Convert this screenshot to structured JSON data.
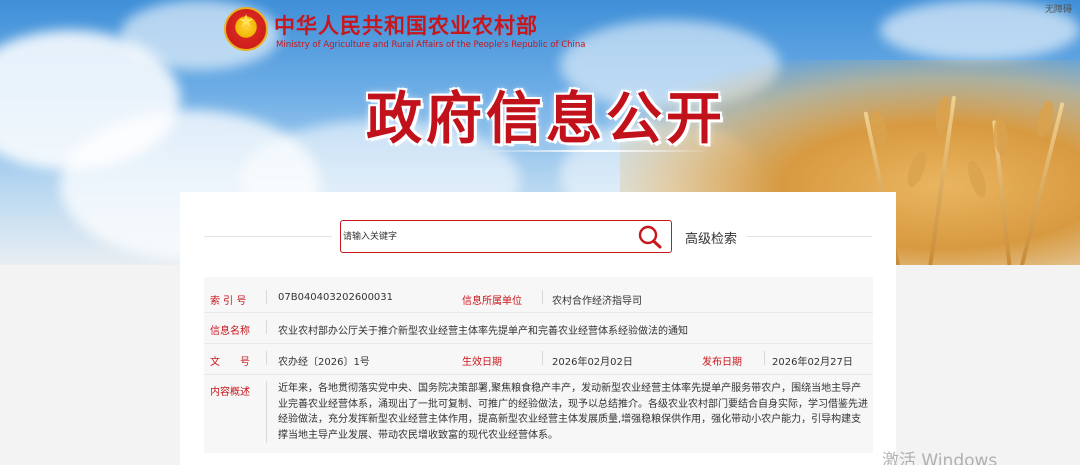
{
  "header": {
    "ministry_cn": "中华人民共和国农业农村部",
    "ministry_en": "Ministry of Agriculture and Rural Affairs of the People's Republic of China",
    "accessibility": "无障碍",
    "banner_title": "政府信息公开",
    "emblem_icon": "national-emblem"
  },
  "search": {
    "placeholder": "请输入关键字",
    "icon": "search-icon",
    "advanced_label": "高级检索"
  },
  "info": {
    "index_label": "索 引 号",
    "index_value": "07B040403202600031",
    "unit_label": "信息所属单位",
    "unit_value": "农村合作经济指导司",
    "name_label": "信息名称",
    "name_value": "农业农村部办公厅关于推介新型农业经营主体率先提单产和完善农业经营体系经验做法的通知",
    "doc_label": "文　　号",
    "doc_value": "农办经〔2026〕1号",
    "effective_label": "生效日期",
    "effective_value": "2026年02月02日",
    "publish_label": "发布日期",
    "publish_value": "2026年02月27日",
    "summary_label": "内容概述",
    "summary_value": "近年来，各地贯彻落实党中央、国务院决策部署,聚焦粮食稳产丰产，发动新型农业经营主体率先提单产服务带农户，围绕当地主导产业完善农业经营体系，涌现出了一批可复制、可推广的经验做法，现予以总结推介。各级农业农村部门要结合自身实际，学习借鉴先进经验做法，充分发挥新型农业经营主体作用，提高新型农业经营主体发展质量,增强稳粮保供作用，强化带动小农户能力，引导构建支撑当地主导产业发展、带动农民增收致富的现代农业经营体系。"
  },
  "watermark": "激活 Windows",
  "colors": {
    "accent_red": "#c8161d",
    "text": "#333333",
    "panel": "#f7f7f7"
  }
}
